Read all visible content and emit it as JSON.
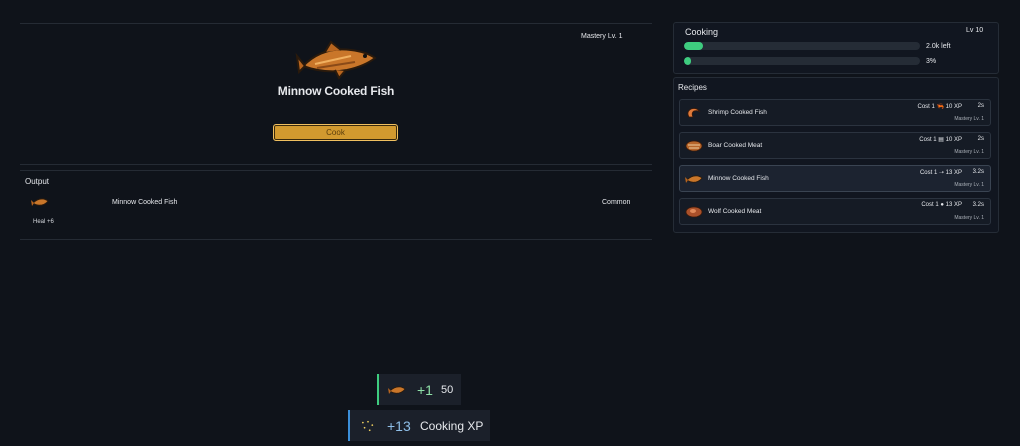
{
  "action": {
    "mastery": "Mastery Lv. 1",
    "title": "Minnow Cooked Fish",
    "button": "Cook",
    "icon": "minnow-cooked-fish-icon"
  },
  "output": {
    "title": "Output",
    "item_name": "Minnow Cooked Fish",
    "rarity": "Common",
    "stat": "Heal +6"
  },
  "skill": {
    "name": "Cooking",
    "level": "Lv 10",
    "bar1_text": "2.0k left",
    "bar1_progress": 0.08,
    "bar2_text": "3%",
    "bar2_progress": 0.03
  },
  "recipes": {
    "title": "Recipes",
    "items": [
      {
        "name": "Shrimp Cooked Fish",
        "cost": "Cost 1 🦐 10 XP",
        "time": "2s",
        "mastery": "Mastery Lv. 1",
        "icon": "shrimp-icon"
      },
      {
        "name": "Boar Cooked Meat",
        "cost": "Cost 1 ▤ 10 XP",
        "time": "2s",
        "mastery": "Mastery Lv. 1",
        "icon": "boar-meat-icon"
      },
      {
        "name": "Minnow Cooked Fish",
        "cost": "Cost 1 ➝ 13 XP",
        "time": "3.2s",
        "mastery": "Mastery Lv. 1",
        "icon": "minnow-icon"
      },
      {
        "name": "Wolf Cooked Meat",
        "cost": "Cost 1 ● 13 XP",
        "time": "3.2s",
        "mastery": "Mastery Lv. 1",
        "icon": "wolf-meat-icon"
      }
    ]
  },
  "toasts": {
    "item_plus": "+1",
    "item_count": "50",
    "xp_plus": "+13",
    "xp_label": "Cooking XP"
  },
  "colors": {
    "accent_button": "#d29a2f",
    "progress": "#3ecc7f"
  }
}
